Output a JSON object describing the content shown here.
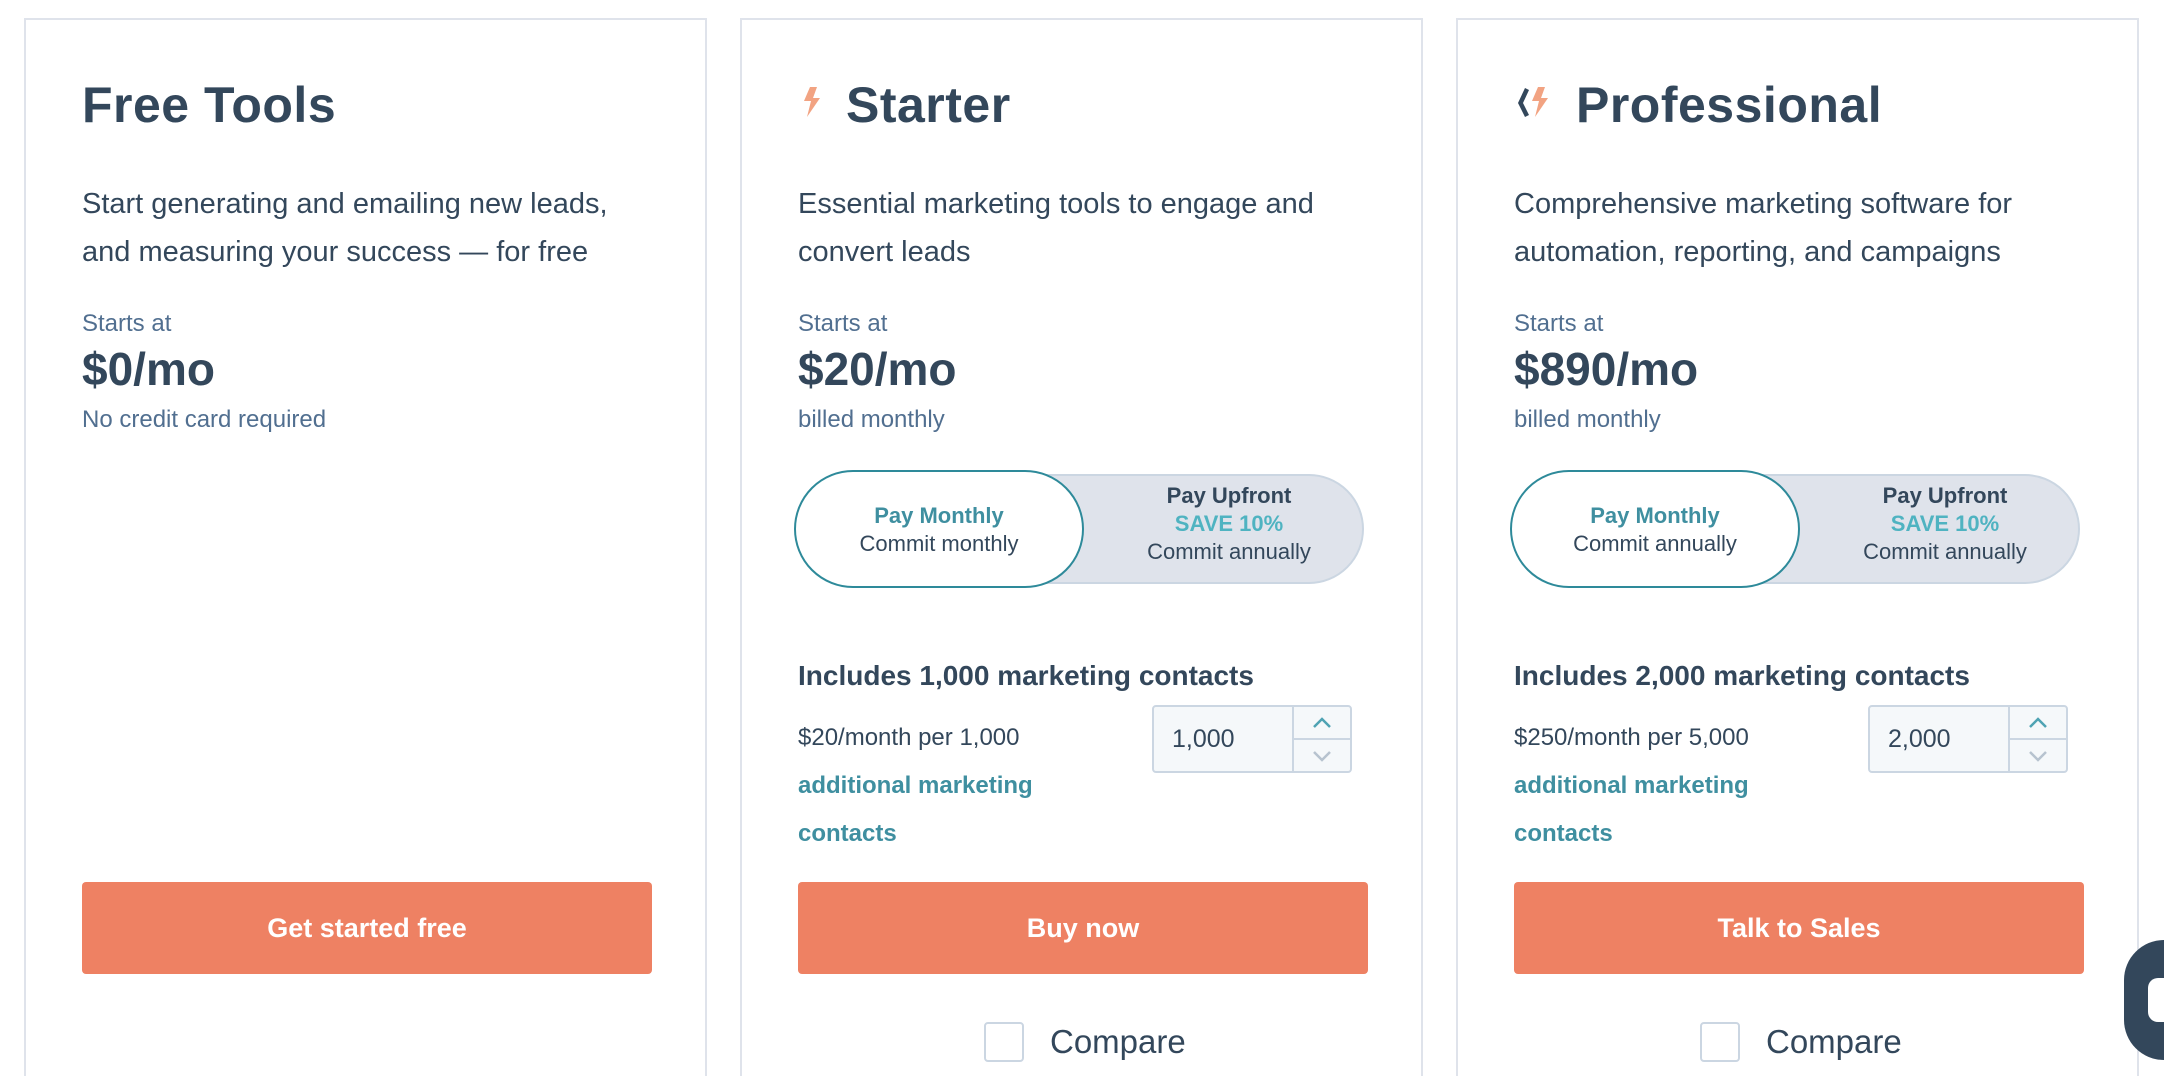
{
  "plans": [
    {
      "title": "Free Tools",
      "description": "Start generating and emailing new leads, and measuring your success — for free",
      "starts_at": "Starts at",
      "price": "$0/mo",
      "billing_note": "No credit card required",
      "cta": "Get started free"
    },
    {
      "title": "Starter",
      "logo_icon": "hubspot-starter-sprocket-icon",
      "description": "Essential marketing tools to engage and convert leads",
      "starts_at": "Starts at",
      "price": "$20/mo",
      "billing_note": "billed monthly",
      "toggle": {
        "left_title": "Pay Monthly",
        "left_sub": "Commit monthly",
        "right_title": "Pay Upfront",
        "right_save": "SAVE 10%",
        "right_sub": "Commit annually"
      },
      "includes": "Includes 1,000 marketing contacts",
      "per_text": "$20/month per 1,000",
      "per_link": "additional marketing contacts",
      "stepper_value": "1,000",
      "cta": "Buy now",
      "compare": "Compare"
    },
    {
      "title": "Professional",
      "logo_icon": "hubspot-professional-sprocket-icon",
      "description": "Comprehensive marketing software for automation, reporting, and campaigns",
      "starts_at": "Starts at",
      "price": "$890/mo",
      "billing_note": "billed monthly",
      "toggle": {
        "left_title": "Pay Monthly",
        "left_sub": "Commit annually",
        "right_title": "Pay Upfront",
        "right_save": "SAVE 10%",
        "right_sub": "Commit annually"
      },
      "includes": "Includes 2,000 marketing contacts",
      "per_text": "$250/month per 5,000",
      "per_link": "additional marketing contacts",
      "stepper_value": "2,000",
      "cta": "Talk to Sales",
      "compare": "Compare"
    }
  ],
  "colors": {
    "accent_orange": "#ee8163",
    "teal": "#3f8fa0",
    "text_dark": "#33475b",
    "border": "#dfe3eb"
  }
}
